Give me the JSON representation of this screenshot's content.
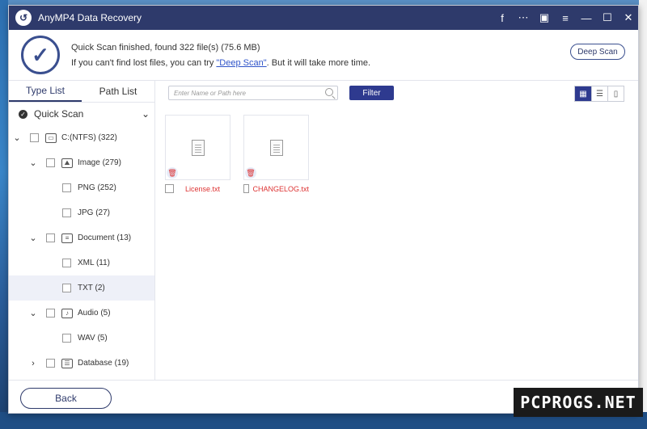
{
  "window": {
    "title": "AnyMP4 Data Recovery"
  },
  "titlebar_icons": [
    "facebook-icon",
    "feedback-icon",
    "save-icon",
    "menu-icon",
    "minimize-icon",
    "maximize-icon",
    "close-icon"
  ],
  "status": {
    "line1": "Quick Scan finished, found 322 file(s) (75.6 MB)",
    "line2_prefix": "If you can't find lost files, you can try ",
    "line2_link": "\"Deep Scan\"",
    "line2_suffix": ". But it will take more time.",
    "deep_scan_button": "Deep Scan"
  },
  "sidebar": {
    "tabs": [
      "Type List",
      "Path List"
    ],
    "active_tab": "Type List",
    "scan_mode": "Quick Scan",
    "tree": [
      {
        "label": "C:(NTFS) (322)",
        "level": 0,
        "expanded": true,
        "icon": "drive-icon"
      },
      {
        "label": "Image (279)",
        "level": 1,
        "expanded": true,
        "icon": "image-icon"
      },
      {
        "label": "PNG (252)",
        "level": 2
      },
      {
        "label": "JPG (27)",
        "level": 2
      },
      {
        "label": "Document (13)",
        "level": 1,
        "expanded": true,
        "icon": "document-icon"
      },
      {
        "label": "XML (11)",
        "level": 2
      },
      {
        "label": "TXT (2)",
        "level": 2,
        "selected": true
      },
      {
        "label": "Audio (5)",
        "level": 1,
        "expanded": true,
        "icon": "audio-icon"
      },
      {
        "label": "WAV (5)",
        "level": 2
      },
      {
        "label": "Database (19)",
        "level": 1,
        "expanded": false,
        "icon": "database-icon"
      }
    ]
  },
  "toolbar": {
    "search_placeholder": "Enter Name or Path here",
    "filter_label": "Filter",
    "view_modes": [
      "grid-view-icon",
      "list-view-icon",
      "detail-view-icon"
    ],
    "active_view": "grid-view-icon"
  },
  "files": [
    {
      "name": "License.txt"
    },
    {
      "name": "CHANGELOG.txt"
    }
  ],
  "footer": {
    "back_label": "Back"
  },
  "watermark": "PCPROGS.NET",
  "colors": {
    "titlebar": "#2e3a6b",
    "accent": "#2e3a8f",
    "deleted_file": "#d33333",
    "link": "#2f54c9"
  }
}
